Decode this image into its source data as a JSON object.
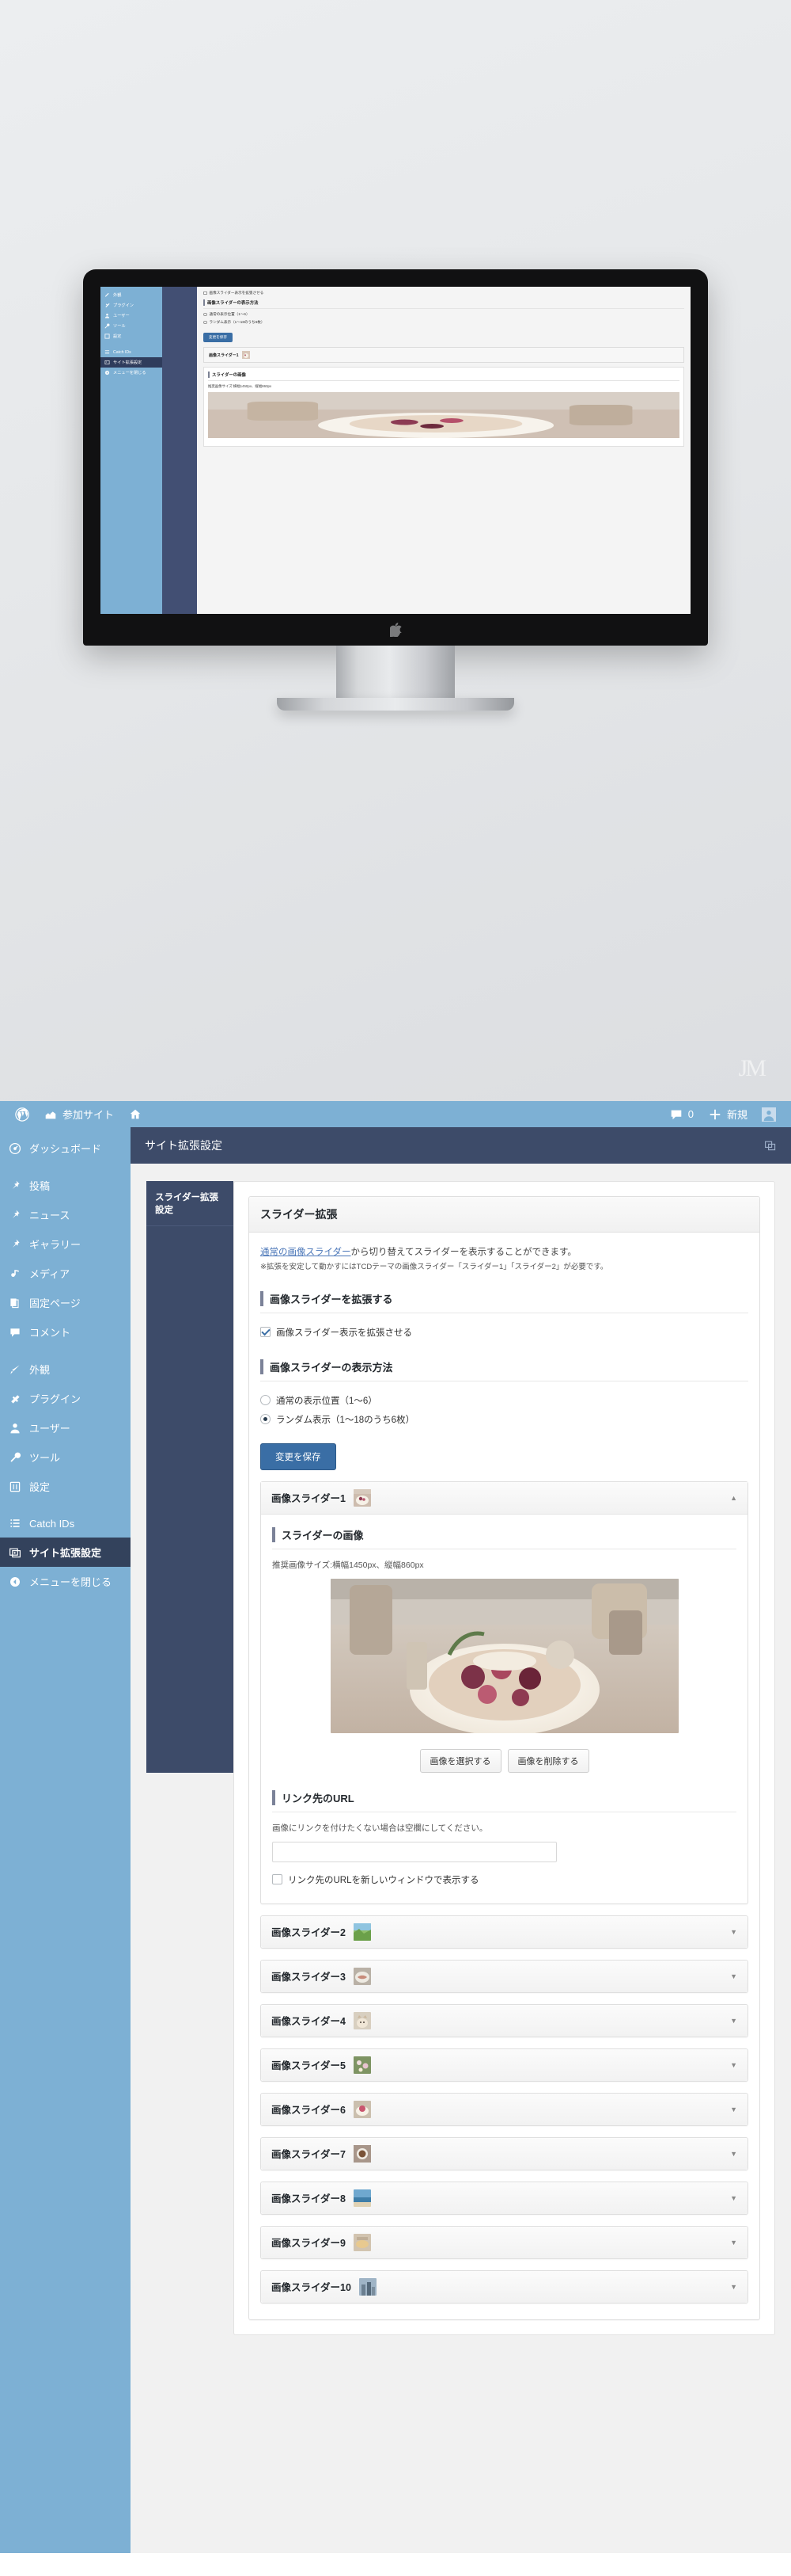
{
  "hero": {
    "watermark": "JM",
    "device": "imac-desktop-computer",
    "mini": {
      "menu": [
        {
          "label": "外観",
          "icon": "appearance-icon"
        },
        {
          "label": "プラグイン",
          "icon": "plugins-icon"
        },
        {
          "label": "ユーザー",
          "icon": "users-icon"
        },
        {
          "label": "ツール",
          "icon": "tools-icon"
        },
        {
          "label": "設定",
          "icon": "settings-icon"
        },
        {
          "label": "Catch IDs",
          "icon": "list-icon"
        },
        {
          "label": "サイト拡張設定",
          "icon": "site-extension-icon"
        },
        {
          "label": "メニューを閉じる",
          "icon": "collapse-icon"
        }
      ],
      "checkbox_label": "画像スライダー表示を拡張させる",
      "section_title": "画像スライダーの表示方法",
      "radio1": "通常の表示位置（1〜6）",
      "radio2": "ランダム表示（1〜18のうち6枚）",
      "save_label": "変更を保存",
      "accordion_label": "画像スライダー1",
      "image_section_title": "スライダーの画像",
      "recommended": "推奨画像サイズ:横幅1450px、縦幅860px"
    }
  },
  "adminbar": {
    "wp_logo": "wordpress-logo-icon",
    "my_sites_label": "参加サイト",
    "my_sites_icon": "sites-icon",
    "site_home_icon": "home-icon",
    "comments_icon": "comment-bubble-icon",
    "comments_count": "0",
    "new_icon": "plus-icon",
    "new_label": "新規",
    "account_icon": "avatar-icon"
  },
  "sidebar": {
    "items": [
      {
        "label": "ダッシュボード",
        "icon": "dashboard-icon",
        "current": false,
        "gap_after": true
      },
      {
        "label": "投稿",
        "icon": "pin-icon",
        "current": false
      },
      {
        "label": "ニュース",
        "icon": "pin-icon",
        "current": false
      },
      {
        "label": "ギャラリー",
        "icon": "pin-icon",
        "current": false
      },
      {
        "label": "メディア",
        "icon": "media-icon",
        "current": false
      },
      {
        "label": "固定ページ",
        "icon": "pages-icon",
        "current": false
      },
      {
        "label": "コメント",
        "icon": "comment-bubble-icon",
        "current": false,
        "gap_after": true
      },
      {
        "label": "外観",
        "icon": "appearance-brush-icon",
        "current": false
      },
      {
        "label": "プラグイン",
        "icon": "plugin-icon",
        "current": false
      },
      {
        "label": "ユーザー",
        "icon": "user-icon",
        "current": false
      },
      {
        "label": "ツール",
        "icon": "wrench-icon",
        "current": false
      },
      {
        "label": "設定",
        "icon": "settings-sliders-icon",
        "current": false,
        "gap_after": true
      },
      {
        "label": "Catch IDs",
        "icon": "list-icon",
        "current": false
      },
      {
        "label": "サイト拡張設定",
        "icon": "site-extension-icon",
        "current": true
      },
      {
        "label": "メニューを閉じる",
        "icon": "collapse-arrow-icon",
        "current": false
      }
    ]
  },
  "screen": {
    "title": "サイト拡張設定",
    "help_icon": "screen-options-icon"
  },
  "subnav": {
    "items": [
      {
        "label": "スライダー拡張設定",
        "active": true
      }
    ]
  },
  "panel": {
    "title": "スライダー拡張",
    "desc_link": "通常の画像スライダー",
    "desc_rest": "から切り替えてスライダーを表示することができます。",
    "desc_note": "※拡張を安定して動かすにはTCDテーマの画像スライダー「スライダー1」「スライダー2」が必要です。"
  },
  "sections": {
    "extend": {
      "title": "画像スライダーを拡張する",
      "checkbox_label": "画像スライダー表示を拡張させる",
      "checked": true
    },
    "display_method": {
      "title": "画像スライダーの表示方法",
      "options": [
        {
          "label": "通常の表示位置（1〜6）",
          "selected": false
        },
        {
          "label": "ランダム表示（1〜18のうち6枚）",
          "selected": true
        }
      ]
    },
    "save_button": "変更を保存"
  },
  "slider_open": {
    "header_label": "画像スライダー1",
    "thumb": "food-bowl-thumbnail",
    "arrow": "chevron-up-icon",
    "image_section": {
      "title": "スライダーの画像",
      "recommended": "推奨画像サイズ:横幅1450px、縦幅860px",
      "preview_alt": "acai-bowl-photo-preview",
      "select_button": "画像を選択する",
      "delete_button": "画像を削除する"
    },
    "link_section": {
      "title": "リンク先のURL",
      "hint": "画像にリンクを付けたくない場合は空欄にしてください。",
      "input_value": "",
      "input_placeholder": "",
      "checkbox_label": "リンク先のURLを新しいウィンドウで表示する",
      "checked": false
    }
  },
  "slider_rows": [
    {
      "label": "画像スライダー2",
      "thumb": "landscape-green-thumbnail",
      "arrow": "chevron-down-icon"
    },
    {
      "label": "画像スライダー3",
      "thumb": "seafood-plate-thumbnail",
      "arrow": "chevron-down-icon"
    },
    {
      "label": "画像スライダー4",
      "thumb": "cat-thumbnail",
      "arrow": "chevron-down-icon"
    },
    {
      "label": "画像スライダー5",
      "thumb": "flowers-thumbnail",
      "arrow": "chevron-down-icon"
    },
    {
      "label": "画像スライダー6",
      "thumb": "dessert-thumbnail",
      "arrow": "chevron-down-icon"
    },
    {
      "label": "画像スライダー7",
      "thumb": "coffee-thumbnail",
      "arrow": "chevron-down-icon"
    },
    {
      "label": "画像スライダー8",
      "thumb": "beach-thumbnail",
      "arrow": "chevron-down-icon"
    },
    {
      "label": "画像スライダー9",
      "thumb": "pastry-thumbnail",
      "arrow": "chevron-down-icon"
    },
    {
      "label": "画像スライダー10",
      "thumb": "city-thumbnail",
      "arrow": "chevron-down-icon"
    }
  ],
  "colors": {
    "admin_blue": "#7db0d4",
    "menu_current": "#33425c",
    "screen_title_bg": "#3d4b69",
    "primary_button": "#3a6ea5",
    "link": "#4a76b8"
  }
}
